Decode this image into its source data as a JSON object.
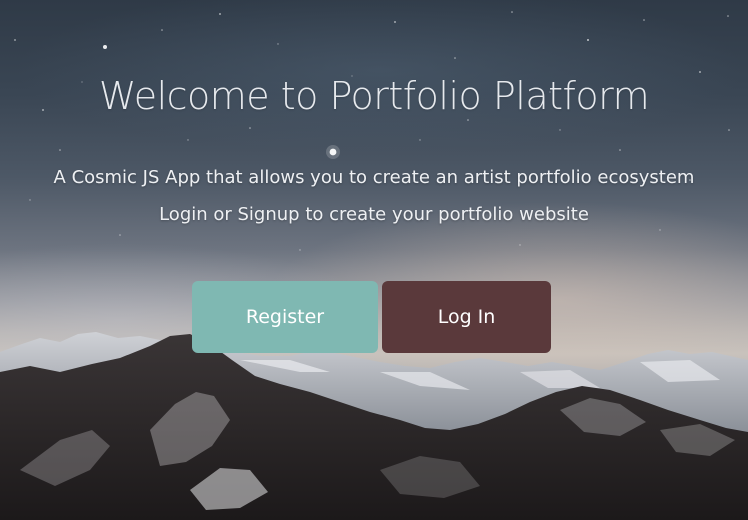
{
  "hero": {
    "title": "Welcome to Portfolio Platform",
    "subtitle_line1": "A Cosmic JS App that  allows you to create an artist portfolio ecosystem",
    "subtitle_line2": "Login or Signup to create your portfolio website"
  },
  "actions": {
    "register_label": "Register",
    "login_label": "Log In"
  },
  "colors": {
    "register_button": "#7fb8b2",
    "login_button": "#5a393b",
    "text": "#eceff2"
  }
}
